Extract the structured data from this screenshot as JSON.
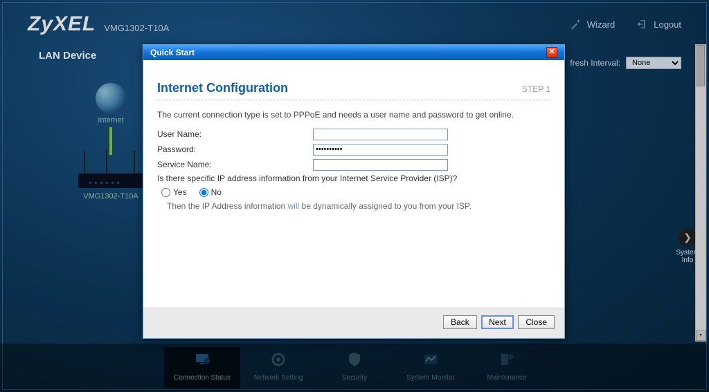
{
  "brand": "ZyXEL",
  "model": "VMG1302-T10A",
  "top_links": {
    "wizard": "Wizard",
    "logout": "Logout"
  },
  "lan_title": "LAN Device",
  "device": {
    "internet_label": "Internet",
    "device_label": "VMG1302-T10A"
  },
  "refresh": {
    "label_suffix": "fresh Interval:",
    "selected": "None"
  },
  "sysinfo": {
    "label": "System Info"
  },
  "nav": {
    "connection_status": "Connection Status",
    "network_setting": "Network Setting",
    "security": "Security",
    "system_monitor": "System Monitor",
    "maintenance": "Maintenance"
  },
  "modal": {
    "title": "Quick Start",
    "section_title": "Internet Configuration",
    "step": "STEP 1",
    "intro": "The current connection type is set to PPPoE and needs a user name and password to get online.",
    "username_label": "User Name:",
    "password_label": "Password:",
    "password_value": "••••••••••",
    "service_label": "Service Name:",
    "isp_question": "Is there specific IP address information from your Internet Service Provider (ISP)?",
    "yes": "Yes",
    "no": "No",
    "hint_prefix": "Then the IP Address information ",
    "hint_will": "will",
    "hint_suffix": " be dynamically assigned to you from your ISP.",
    "buttons": {
      "back": "Back",
      "next": "Next",
      "close": "Close"
    }
  }
}
